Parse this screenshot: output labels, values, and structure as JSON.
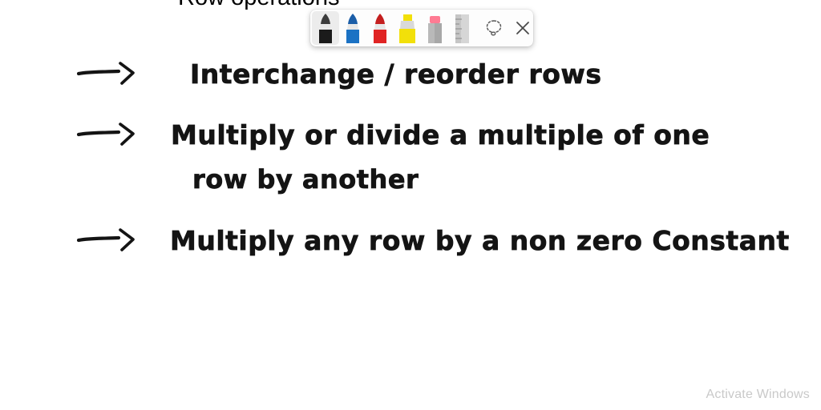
{
  "app": {
    "name": "whiteboard-annotation-overlay",
    "canvas_color": "#ffffff",
    "ink_color": "#141414"
  },
  "toolbar": {
    "name": "pen-toolbar",
    "selected_tool": "black-pen",
    "tools": [
      {
        "id": "black-pen",
        "label": "Black pen",
        "icon": "pen-icon",
        "color": "#1b1b1b",
        "selected": true
      },
      {
        "id": "blue-pen",
        "label": "Blue pen",
        "icon": "pen-icon",
        "color": "#1b72c4",
        "selected": false
      },
      {
        "id": "red-pen",
        "label": "Red pen",
        "icon": "pen-icon",
        "color": "#e02424",
        "selected": false
      },
      {
        "id": "highlighter",
        "label": "Yellow highlighter",
        "icon": "highlighter-icon",
        "color": "#f2e00a",
        "selected": false
      },
      {
        "id": "eraser",
        "label": "Eraser",
        "icon": "eraser-icon",
        "color": "#ff7b93",
        "selected": false
      },
      {
        "id": "ruler",
        "label": "Ruler",
        "icon": "ruler-icon",
        "color": "#c2c2c2",
        "selected": false
      }
    ],
    "actions": [
      {
        "id": "lasso-select",
        "label": "Lasso select",
        "icon": "lasso-select-icon"
      },
      {
        "id": "close",
        "label": "Close",
        "icon": "close-icon"
      }
    ]
  },
  "notes": {
    "title": "Row operations",
    "lines": [
      {
        "id": "line-1",
        "bullet": "arrow",
        "text": "Interchange / reorder  rows"
      },
      {
        "id": "line-2",
        "bullet": "arrow",
        "text": "Multiply or divide  a  multiple of one"
      },
      {
        "id": "line-2b",
        "bullet": "none",
        "text": "row  by another"
      },
      {
        "id": "line-3",
        "bullet": "arrow",
        "text": "Multiply any row  by a  non zero Constant"
      }
    ]
  },
  "watermark": {
    "text": "Activate Windows"
  }
}
